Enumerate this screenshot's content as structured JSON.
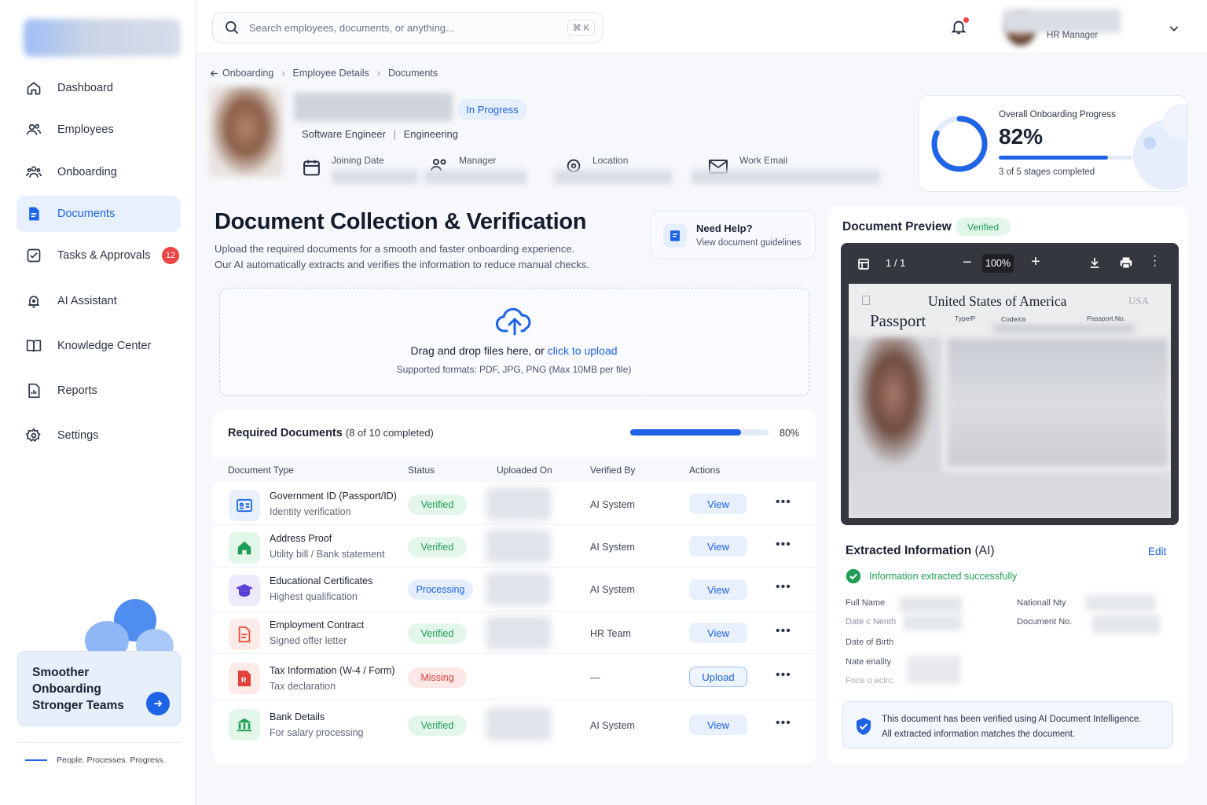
{
  "sidebar": {
    "items": [
      {
        "label": "Dashboard",
        "icon": "home-icon"
      },
      {
        "label": "Employees",
        "icon": "users-icon"
      },
      {
        "label": "Onboarding",
        "icon": "user-group-icon"
      },
      {
        "label": "Documents",
        "icon": "document-icon",
        "active": true
      },
      {
        "label": "Tasks & Approvals",
        "icon": "checkbox-icon",
        "badge": "12"
      },
      {
        "label": "AI Assistant",
        "icon": "ai-bell-icon"
      },
      {
        "label": "Knowledge Center",
        "icon": "book-icon"
      },
      {
        "label": "Reports",
        "icon": "report-icon"
      },
      {
        "label": "Settings",
        "icon": "gear-icon"
      }
    ],
    "promo": {
      "line1": "Smoother",
      "line2": "Onboarding",
      "line3": "Stronger Teams"
    },
    "footer": "People. Processes. Progress."
  },
  "topbar": {
    "search_placeholder": "Search employees, documents, or anything...",
    "shortcut": "⌘ K",
    "user_role": "HR Manager"
  },
  "breadcrumb": [
    "Onboarding",
    "Employee Details",
    "Documents"
  ],
  "employee": {
    "status": "In Progress",
    "title": "Software Engineer",
    "department": "Engineering",
    "fields": {
      "joining_date": "Joining Date",
      "manager": "Manager",
      "location": "Location",
      "work_email": "Work Email"
    }
  },
  "progress": {
    "label": "Overall Onboarding Progress",
    "percent_text": "82%",
    "percent": 82,
    "stages": "3 of 5 stages completed"
  },
  "main": {
    "title": "Document Collection & Verification",
    "desc1": "Upload the required documents for a smooth and faster onboarding experience.",
    "desc2": "Our AI automatically extracts and verifies the information to reduce manual checks.",
    "help": {
      "title": "Need Help?",
      "link": "View document guidelines"
    },
    "upload": {
      "text": "Drag and drop files here, or ",
      "link": "click to upload",
      "formats": "Supported formats: PDF, JPG, PNG (Max 10MB per file)"
    }
  },
  "required": {
    "title": "Required Documents",
    "count": "(8 of 10 completed)",
    "percent_text": "80%",
    "percent": 80,
    "headers": [
      "Document Type",
      "Status",
      "Uploaded On",
      "Verified By",
      "Actions"
    ],
    "rows": [
      {
        "name": "Government ID (Passport/ID)",
        "sub": "Identity verification",
        "status": "Verified",
        "kind": "green",
        "by": "AI System",
        "action": "View",
        "icon": "id-card-icon",
        "color": "#e8f0fd"
      },
      {
        "name": "Address Proof",
        "sub": "Utility bill / Bank statement",
        "status": "Verified",
        "kind": "green",
        "by": "AI System",
        "action": "View",
        "icon": "house-icon",
        "color": "#e3f6ea"
      },
      {
        "name": "Educational Certificates",
        "sub": "Highest qualification",
        "status": "Processing",
        "kind": "blue",
        "by": "AI System",
        "action": "View",
        "icon": "graduation-cap-icon",
        "color": "#eeeafc"
      },
      {
        "name": "Employment Contract",
        "sub": "Signed offer letter",
        "status": "Verified",
        "kind": "green",
        "by": "HR Team",
        "action": "View",
        "icon": "contract-icon",
        "color": "#fdebe7"
      },
      {
        "name": "Tax Information (W-4 / Form)",
        "sub": "Tax declaration",
        "status": "Missing",
        "kind": "red",
        "by": "—",
        "action": "Upload",
        "icon": "tax-form-icon",
        "color": "#fdebe7"
      },
      {
        "name": "Bank Details",
        "sub": "For salary processing",
        "status": "Verified",
        "kind": "green",
        "by": "AI System",
        "action": "View",
        "icon": "bank-icon",
        "color": "#e3f6ea"
      }
    ]
  },
  "preview": {
    "title": "Document Preview",
    "badge": "Verified",
    "page": "1 / 1",
    "zoom": "100%",
    "passport": {
      "country": "United States of America",
      "doc": "Passport",
      "type": "Type/P",
      "code": "Code/㎝",
      "no": "Passport No.",
      "usa": "USA"
    }
  },
  "extracted": {
    "title": "Extracted Information",
    "ai": "(AI)",
    "edit": "Edit",
    "success": "Information extracted successfully",
    "labels_left": [
      "Full Name",
      "Date c Nenth",
      "Date of Birth",
      "Nate enality",
      "Fnce o ecirc."
    ],
    "labels_right": [
      "Nationall Nty",
      "Document No."
    ],
    "note1": "This document has been verified using AI Document Intelligence.",
    "note2": "All extracted information matches the document."
  }
}
